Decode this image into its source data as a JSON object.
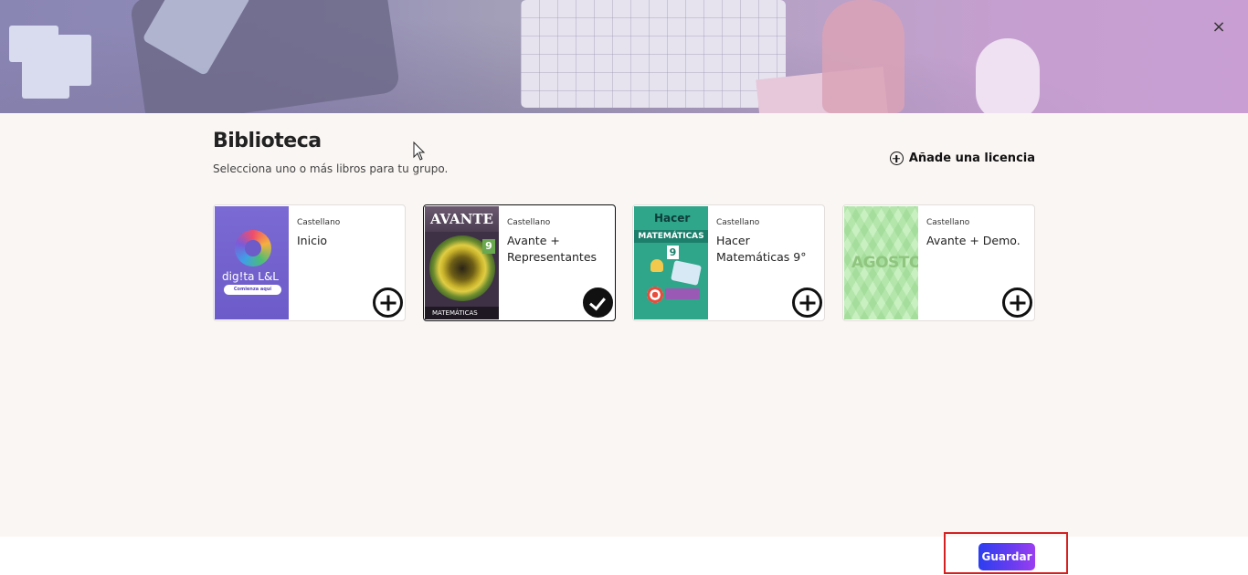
{
  "library": {
    "title": "Biblioteca",
    "subtitle": "Selecciona uno o más libros para tu grupo.",
    "add_license_label": "Añade una licencia",
    "close_label": "×"
  },
  "books": [
    {
      "language": "Castellano",
      "name": "Inicio",
      "selected": false,
      "cover": {
        "logo": "dig!ta L&L",
        "pill": "Comienza aquí"
      }
    },
    {
      "language": "Castellano",
      "name": "Avante + Representantes",
      "selected": true,
      "cover": {
        "brand": "AVANTE",
        "grade": "9",
        "subject": "MATEMÁTICAS"
      }
    },
    {
      "language": "Castellano",
      "name": "Hacer Matemáticas 9°",
      "selected": false,
      "cover": {
        "brand": "Hacer",
        "subject": "MATEMÁTICAS",
        "grade": "9"
      }
    },
    {
      "language": "Castellano",
      "name": "Avante + Demo.",
      "selected": false,
      "cover": {
        "word": "AGOSTO"
      }
    }
  ],
  "footer": {
    "save_label": "Guardar"
  },
  "colors": {
    "accent_start": "#2b3ff0",
    "accent_end": "#9b3ef0",
    "highlight_border": "#d32121"
  }
}
